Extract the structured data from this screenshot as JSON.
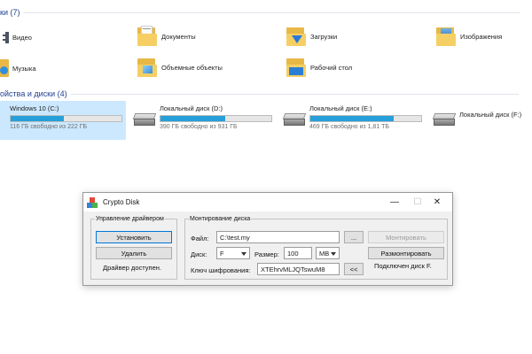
{
  "explorer": {
    "folders_header": "ки (7)",
    "drives_header": "ойства и диски (4)",
    "folders": [
      {
        "label": "Видео",
        "icon": "video-folder-icon"
      },
      {
        "label": "Документы",
        "icon": "documents-folder-icon"
      },
      {
        "label": "Загрузки",
        "icon": "downloads-folder-icon"
      },
      {
        "label": "Изображения",
        "icon": "pictures-folder-icon"
      },
      {
        "label": "Музыка",
        "icon": "music-folder-icon"
      },
      {
        "label": "Объемные объекты",
        "icon": "3d-objects-folder-icon"
      },
      {
        "label": "Рабочий стол",
        "icon": "desktop-folder-icon"
      }
    ],
    "drives": [
      {
        "name": "Windows 10 (C:)",
        "free": "116 ГБ свободно из 222 ГБ",
        "used_fraction": 0.48,
        "selected": true
      },
      {
        "name": "Локальный диск (D:)",
        "free": "390 ГБ свободно из 931 ГБ",
        "used_fraction": 0.58,
        "selected": false
      },
      {
        "name": "Локальный диск (E:)",
        "free": "469 ГБ свободно из 1,81 ТБ",
        "used_fraction": 0.75,
        "selected": false
      },
      {
        "name": "Локальный диск (F:)",
        "free": "",
        "used_fraction": null,
        "selected": false
      }
    ],
    "bar_color": "#26a0da",
    "selected_color": "#cce8ff"
  },
  "dialog": {
    "title": "Crypto Disk",
    "controls": {
      "minimize": "—",
      "maximize": "☐",
      "close": "✕"
    },
    "driver_group": {
      "legend": "Управление драйвером",
      "install_label": "Установить",
      "remove_label": "Удалить",
      "status": "Драйвер доступен."
    },
    "mount_group": {
      "legend": "Монтирование диска",
      "file_label": "Файл:",
      "file_value": "C:\\test.my",
      "browse_label": "...",
      "mount_label": "Монтировать",
      "disk_label": "Диск:",
      "disk_value": "F",
      "size_label": "Размер:",
      "size_value": "100",
      "unit_value": "MB",
      "unmount_label": "Размонтировать",
      "key_label": "Ключ шифрования:",
      "key_value": "XTEhrvMLJQTswuM8",
      "generate_label": "<<",
      "status": "Подключен диск F."
    }
  }
}
